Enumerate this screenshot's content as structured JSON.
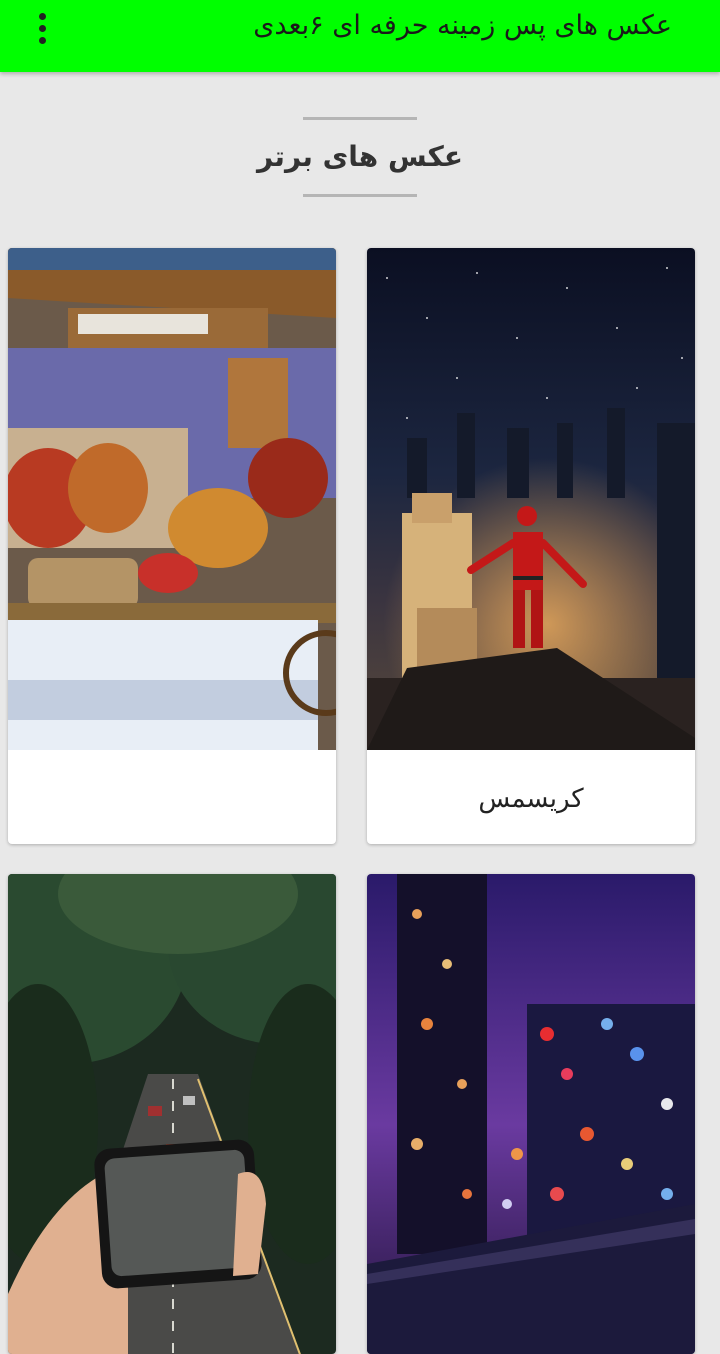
{
  "appbar": {
    "title": "عکس های پس زمینه حرفه ای ۶بعدی",
    "menu_icon": "more-vert-icon"
  },
  "section": {
    "title": "عکس های برتر"
  },
  "cards": [
    {
      "label": "کریسمس",
      "image": "santa on rooftop above night city"
    },
    {
      "label": "",
      "image": "market stall with autumn decorations"
    },
    {
      "label": "",
      "image": "blurred city lights at night"
    },
    {
      "label": "",
      "image": "hand holding phone over forest road"
    }
  ],
  "colors": {
    "appbar": "#00ff00",
    "background": "#e8e8e8",
    "card": "#ffffff"
  }
}
